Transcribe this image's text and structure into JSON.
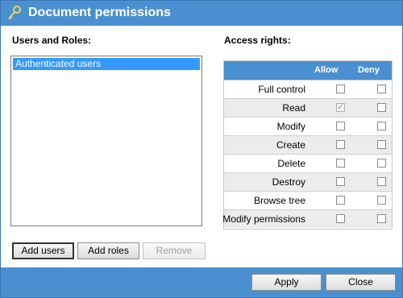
{
  "dialog": {
    "title": "Document permissions",
    "title_icon": "key-icon",
    "accent_color": "#4a90d0"
  },
  "users": {
    "label": "Users and Roles:",
    "items": [
      "Authenticated users"
    ],
    "selected_index": 0
  },
  "rights": {
    "label": "Access rights:",
    "col_allow": "Allow",
    "col_deny": "Deny",
    "rows": [
      {
        "name": "Full control",
        "allow": false,
        "deny": false
      },
      {
        "name": "Read",
        "allow": true,
        "allow_disabled": true,
        "deny": false
      },
      {
        "name": "Modify",
        "allow": false,
        "deny": false
      },
      {
        "name": "Create",
        "allow": false,
        "deny": false
      },
      {
        "name": "Delete",
        "allow": false,
        "deny": false
      },
      {
        "name": "Destroy",
        "allow": false,
        "deny": false
      },
      {
        "name": "Browse tree",
        "allow": false,
        "deny": false
      },
      {
        "name": "Modify permissions",
        "allow": false,
        "deny": false
      }
    ]
  },
  "buttons": {
    "add_users": "Add users",
    "add_roles": "Add roles",
    "remove": "Remove",
    "apply": "Apply",
    "close": "Close"
  }
}
